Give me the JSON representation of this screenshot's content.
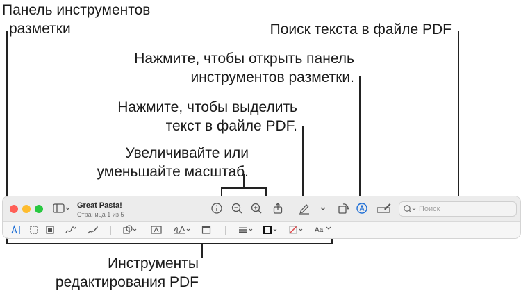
{
  "callouts": {
    "markup_toolbar": [
      "Панель инструментов",
      "разметки"
    ],
    "search_text": "Поиск текста в файле PDF",
    "open_markup": [
      "Нажмите, чтобы открыть панель",
      "инструментов разметки."
    ],
    "highlight": [
      "Нажмите, чтобы выделить",
      "текст в файле PDF."
    ],
    "zoom": [
      "Увеличивайте или",
      "уменьшайте масштаб."
    ],
    "edit_tools": [
      "Инструменты",
      "редактирования PDF"
    ]
  },
  "window": {
    "title": "Great Pasta!",
    "subtitle": "Страница 1 из 5",
    "search_placeholder": "Поиск",
    "text_style_label": "Aa"
  },
  "colors": {
    "close": "#ff5f57",
    "minimize": "#febc2e",
    "zoom": "#28c840",
    "accent": "#1f6fd6",
    "markup_red": "#e0484b"
  },
  "icons": {
    "sidebar": "sidebar-icon",
    "info": "info-icon",
    "zoom_out": "zoom-out-icon",
    "zoom_in": "zoom-in-icon",
    "share": "share-icon",
    "highlight": "highlighter-pen-icon",
    "rotate": "rotate-icon",
    "markup": "markup-pen-circle-icon",
    "form": "form-fill-icon",
    "search": "magnifier-icon"
  }
}
